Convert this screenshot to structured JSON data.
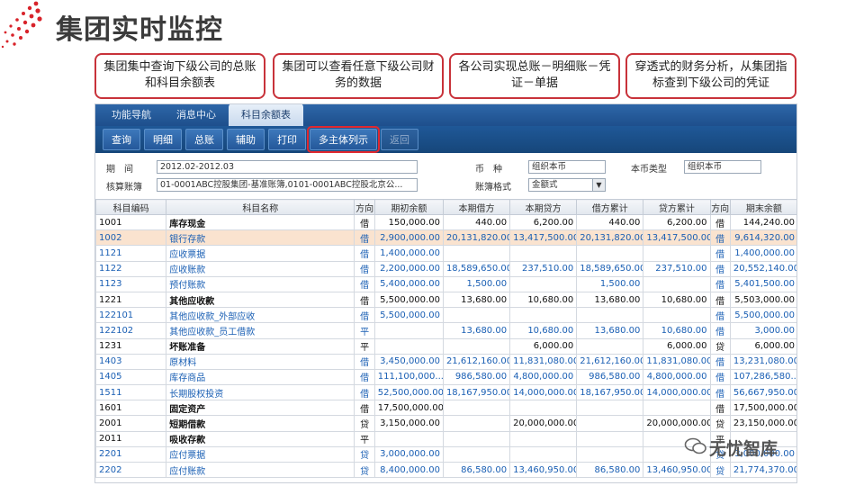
{
  "slide": {
    "title": "集团实时监控",
    "callouts": [
      "集团集中查询下级公司的总账和科目余额表",
      "集团可以查看任意下级公司财务的数据",
      "各公司实现总账－明细账－凭证－单据",
      "穿透式的财务分析，从集团指标查到下级公司的凭证"
    ],
    "watermark": "无忧智库"
  },
  "nav": {
    "tabs": [
      "功能导航",
      "消息中心",
      "科目余额表"
    ],
    "active_tab": "科目余额表"
  },
  "toolbar": {
    "query": "查询",
    "detail": "明细",
    "ledger": "总账",
    "aux": "辅助",
    "print": "打印",
    "multi": "多主体列示",
    "back": "返回"
  },
  "filters": {
    "period_label": "期　间",
    "period_value": "2012.02-2012.03",
    "currency_label": "币　种",
    "currency_value": "组织本币",
    "local_type_label": "本币类型",
    "local_type_value": "组织本币",
    "book_label": "核算账簿",
    "book_value": "01-0001ABC控股集团-基准账簿,0101-0001ABC控股北京公...",
    "format_label": "账簿格式",
    "format_value": "金额式"
  },
  "table": {
    "columns": [
      "科目编码",
      "科目名称",
      "方向",
      "期初余额",
      "本期借方",
      "本期贷方",
      "借方累计",
      "贷方累计",
      "方向",
      "期末余额"
    ],
    "rows": [
      {
        "code": "1001",
        "name": "库存现金",
        "dir": "借",
        "open": "150,000.00",
        "dr": "440.00",
        "cr": "6,200.00",
        "dr_acc": "440.00",
        "cr_acc": "6,200.00",
        "dir2": "借",
        "close": "144,240.00",
        "level": 1
      },
      {
        "code": "1002",
        "name": "银行存款",
        "dir": "借",
        "open": "2,900,000.00",
        "dr": "20,131,820.00",
        "cr": "13,417,500.00",
        "dr_acc": "20,131,820.00",
        "cr_acc": "13,417,500.00",
        "dir2": "借",
        "close": "9,614,320.00",
        "level": 2,
        "selected": true
      },
      {
        "code": "1121",
        "name": "应收票据",
        "dir": "借",
        "open": "1,400,000.00",
        "dr": "",
        "cr": "",
        "dr_acc": "",
        "cr_acc": "",
        "dir2": "借",
        "close": "1,400,000.00",
        "level": 2
      },
      {
        "code": "1122",
        "name": "应收账款",
        "dir": "借",
        "open": "2,200,000.00",
        "dr": "18,589,650.00",
        "cr": "237,510.00",
        "dr_acc": "18,589,650.00",
        "cr_acc": "237,510.00",
        "dir2": "借",
        "close": "20,552,140.00",
        "level": 2
      },
      {
        "code": "1123",
        "name": "预付账款",
        "dir": "借",
        "open": "5,400,000.00",
        "dr": "1,500.00",
        "cr": "",
        "dr_acc": "1,500.00",
        "cr_acc": "",
        "dir2": "借",
        "close": "5,401,500.00",
        "level": 2
      },
      {
        "code": "1221",
        "name": "其他应收款",
        "dir": "借",
        "open": "5,500,000.00",
        "dr": "13,680.00",
        "cr": "10,680.00",
        "dr_acc": "13,680.00",
        "cr_acc": "10,680.00",
        "dir2": "借",
        "close": "5,503,000.00",
        "level": 1
      },
      {
        "code": "122101",
        "name": "其他应收款_外部应收",
        "dir": "借",
        "open": "5,500,000.00",
        "dr": "",
        "cr": "",
        "dr_acc": "",
        "cr_acc": "",
        "dir2": "借",
        "close": "5,500,000.00",
        "level": 2
      },
      {
        "code": "122102",
        "name": "其他应收款_员工借款",
        "dir": "平",
        "open": "",
        "dr": "13,680.00",
        "cr": "10,680.00",
        "dr_acc": "13,680.00",
        "cr_acc": "10,680.00",
        "dir2": "借",
        "close": "3,000.00",
        "level": 2
      },
      {
        "code": "1231",
        "name": "坏账准备",
        "dir": "平",
        "open": "",
        "dr": "",
        "cr": "6,000.00",
        "dr_acc": "",
        "cr_acc": "6,000.00",
        "dir2": "贷",
        "close": "6,000.00",
        "level": 1
      },
      {
        "code": "1403",
        "name": "原材料",
        "dir": "借",
        "open": "3,450,000.00",
        "dr": "21,612,160.00",
        "cr": "11,831,080.00",
        "dr_acc": "21,612,160.00",
        "cr_acc": "11,831,080.00",
        "dir2": "借",
        "close": "13,231,080.00",
        "level": 2
      },
      {
        "code": "1405",
        "name": "库存商品",
        "dir": "借",
        "open": "111,100,000....",
        "dr": "986,580.00",
        "cr": "4,800,000.00",
        "dr_acc": "986,580.00",
        "cr_acc": "4,800,000.00",
        "dir2": "借",
        "close": "107,286,580....",
        "level": 2
      },
      {
        "code": "1511",
        "name": "长期股权投资",
        "dir": "借",
        "open": "52,500,000.00",
        "dr": "18,167,950.00",
        "cr": "14,000,000.00",
        "dr_acc": "18,167,950.00",
        "cr_acc": "14,000,000.00",
        "dir2": "借",
        "close": "56,667,950.00",
        "level": 2
      },
      {
        "code": "1601",
        "name": "固定资产",
        "dir": "借",
        "open": "17,500,000.00",
        "dr": "",
        "cr": "",
        "dr_acc": "",
        "cr_acc": "",
        "dir2": "借",
        "close": "17,500,000.00",
        "level": 1
      },
      {
        "code": "2001",
        "name": "短期借款",
        "dir": "贷",
        "open": "3,150,000.00",
        "dr": "",
        "cr": "20,000,000.00",
        "dr_acc": "",
        "cr_acc": "20,000,000.00",
        "dir2": "贷",
        "close": "23,150,000.00",
        "level": 1
      },
      {
        "code": "2011",
        "name": "吸收存款",
        "dir": "平",
        "open": "",
        "dr": "",
        "cr": "",
        "dr_acc": "",
        "cr_acc": "",
        "dir2": "平",
        "close": "",
        "level": 1
      },
      {
        "code": "2201",
        "name": "应付票据",
        "dir": "贷",
        "open": "3,000,000.00",
        "dr": "",
        "cr": "",
        "dr_acc": "",
        "cr_acc": "",
        "dir2": "贷",
        "close": "3,000,000.00",
        "level": 2
      },
      {
        "code": "2202",
        "name": "应付账款",
        "dir": "贷",
        "open": "8,400,000.00",
        "dr": "86,580.00",
        "cr": "13,460,950.00",
        "dr_acc": "86,580.00",
        "cr_acc": "13,460,950.00",
        "dir2": "贷",
        "close": "21,774,370.00",
        "level": 2
      }
    ]
  },
  "colors": {
    "accent_red": "#c8323a",
    "nav_blue": "#1f5898",
    "link_blue": "#1a5fb4",
    "selected_row": "#fae3cf"
  }
}
